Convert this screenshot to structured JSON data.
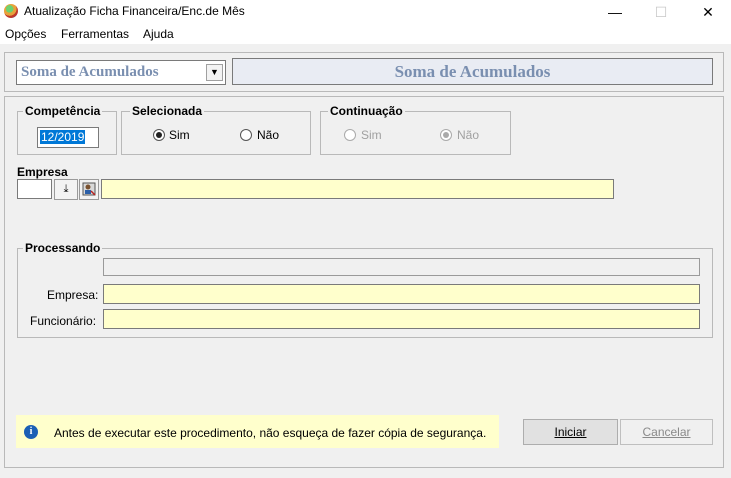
{
  "window": {
    "title": "Atualização Ficha Financeira/Enc.de Mês",
    "minimize_glyph": "—",
    "maximize_glyph": "☐",
    "close_glyph": "✕"
  },
  "menu": [
    "Opções",
    "Ferramentas",
    "Ajuda"
  ],
  "process_select": {
    "value": "Soma de Acumulados"
  },
  "heading": "Soma de Acumulados",
  "competencia": {
    "label": "Competência",
    "value": "12/2019"
  },
  "selecionada": {
    "label": "Selecionada",
    "options": [
      "Sim",
      "Não"
    ],
    "selected": "Sim"
  },
  "continuacao": {
    "label": "Continuação",
    "options": [
      "Sim",
      "Não"
    ],
    "selected": "Não",
    "enabled": false
  },
  "empresa": {
    "label": "Empresa",
    "code": "",
    "name": ""
  },
  "processando": {
    "label": "Processando",
    "progress": 0,
    "empresa_label": "Empresa:",
    "empresa_value": "",
    "funcionario_label": "Funcionário:",
    "funcionario_value": ""
  },
  "info": {
    "icon": "info-icon",
    "text": "Antes de executar este procedimento, não esqueça de fazer cópia de segurança."
  },
  "buttons": {
    "iniciar": "Iniciar",
    "cancelar": "Cancelar"
  },
  "colors": {
    "field_yellow": "#ffffcc",
    "heading_text": "#7a8fb0",
    "selection_blue": "#0078d7"
  }
}
